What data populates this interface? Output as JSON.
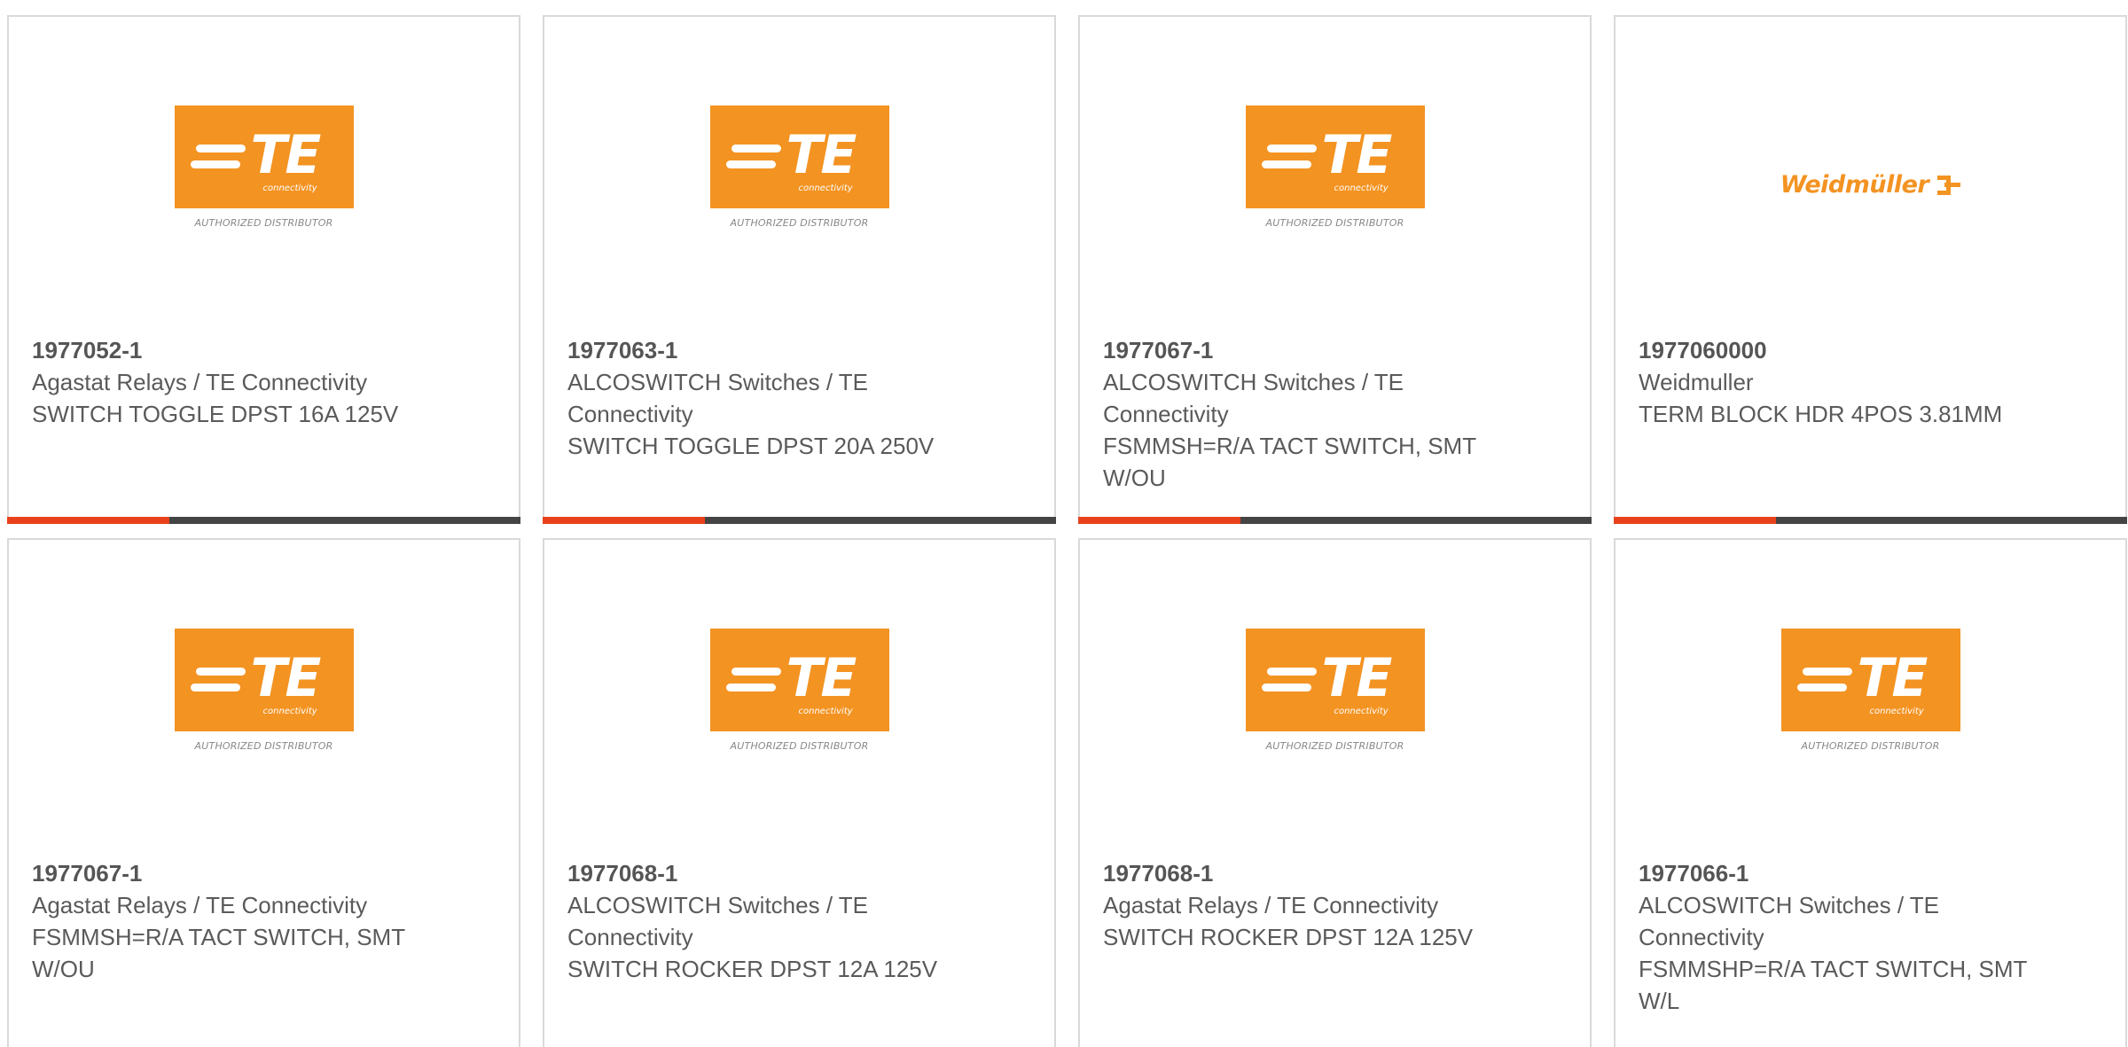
{
  "brand_colors": {
    "te_orange": "#f39322",
    "accent_red": "#e8421c",
    "bar_dark": "#444444"
  },
  "logos": {
    "te": {
      "wordmark": "TE",
      "sub": "connectivity",
      "tagline": "AUTHORIZED DISTRIBUTOR"
    },
    "weidmuller": {
      "wordmark": "Weidmüller"
    }
  },
  "products": [
    {
      "part_number": "1977052-1",
      "manufacturer": "Agastat Relays / TE Connectivity",
      "description": "SWITCH TOGGLE DPST 16A 125V",
      "logo": "te"
    },
    {
      "part_number": "1977063-1",
      "manufacturer": "ALCOSWITCH Switches / TE Connectivity",
      "description": "SWITCH TOGGLE DPST 20A 250V",
      "logo": "te"
    },
    {
      "part_number": "1977067-1",
      "manufacturer": "ALCOSWITCH Switches / TE Connectivity",
      "description": "FSMMSH=R/A TACT SWITCH, SMT W/OU",
      "logo": "te"
    },
    {
      "part_number": "1977060000",
      "manufacturer": "Weidmuller",
      "description": "TERM BLOCK HDR 4POS 3.81MM",
      "logo": "weidmuller"
    },
    {
      "part_number": "1977067-1",
      "manufacturer": "Agastat Relays / TE Connectivity",
      "description": "FSMMSH=R/A TACT SWITCH, SMT W/OU",
      "logo": "te"
    },
    {
      "part_number": "1977068-1",
      "manufacturer": "ALCOSWITCH Switches / TE Connectivity",
      "description": "SWITCH ROCKER DPST 12A 125V",
      "logo": "te"
    },
    {
      "part_number": "1977068-1",
      "manufacturer": "Agastat Relays / TE Connectivity",
      "description": "SWITCH ROCKER DPST 12A 125V",
      "logo": "te"
    },
    {
      "part_number": "1977066-1",
      "manufacturer": "ALCOSWITCH Switches / TE Connectivity",
      "description": "FSMMSHP=R/A TACT SWITCH, SMT W/L",
      "logo": "te"
    }
  ]
}
